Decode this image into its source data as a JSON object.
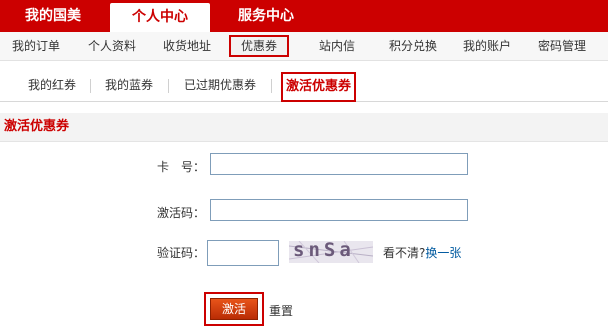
{
  "topnav": {
    "items": [
      "我的国美",
      "个人中心",
      "服务中心"
    ]
  },
  "subnav": {
    "items": [
      "我的订单",
      "个人资料",
      "收货地址",
      "优惠券",
      "站内信",
      "积分兑换",
      "我的账户",
      "密码管理"
    ]
  },
  "tabs": {
    "items": [
      "我的红券",
      "我的蓝券",
      "已过期优惠券",
      "激活优惠券"
    ]
  },
  "section": {
    "title": "激活优惠券"
  },
  "form": {
    "card_label": "卡　号：",
    "code_label": "激活码：",
    "captcha_label": "验证码：",
    "captcha_text": "snSa",
    "hint": "看不清?",
    "refresh_link": "换一张",
    "activate_button": "激活",
    "reset": "重置"
  },
  "colors": {
    "brand": "#cc0000",
    "link": "#005aa0"
  }
}
